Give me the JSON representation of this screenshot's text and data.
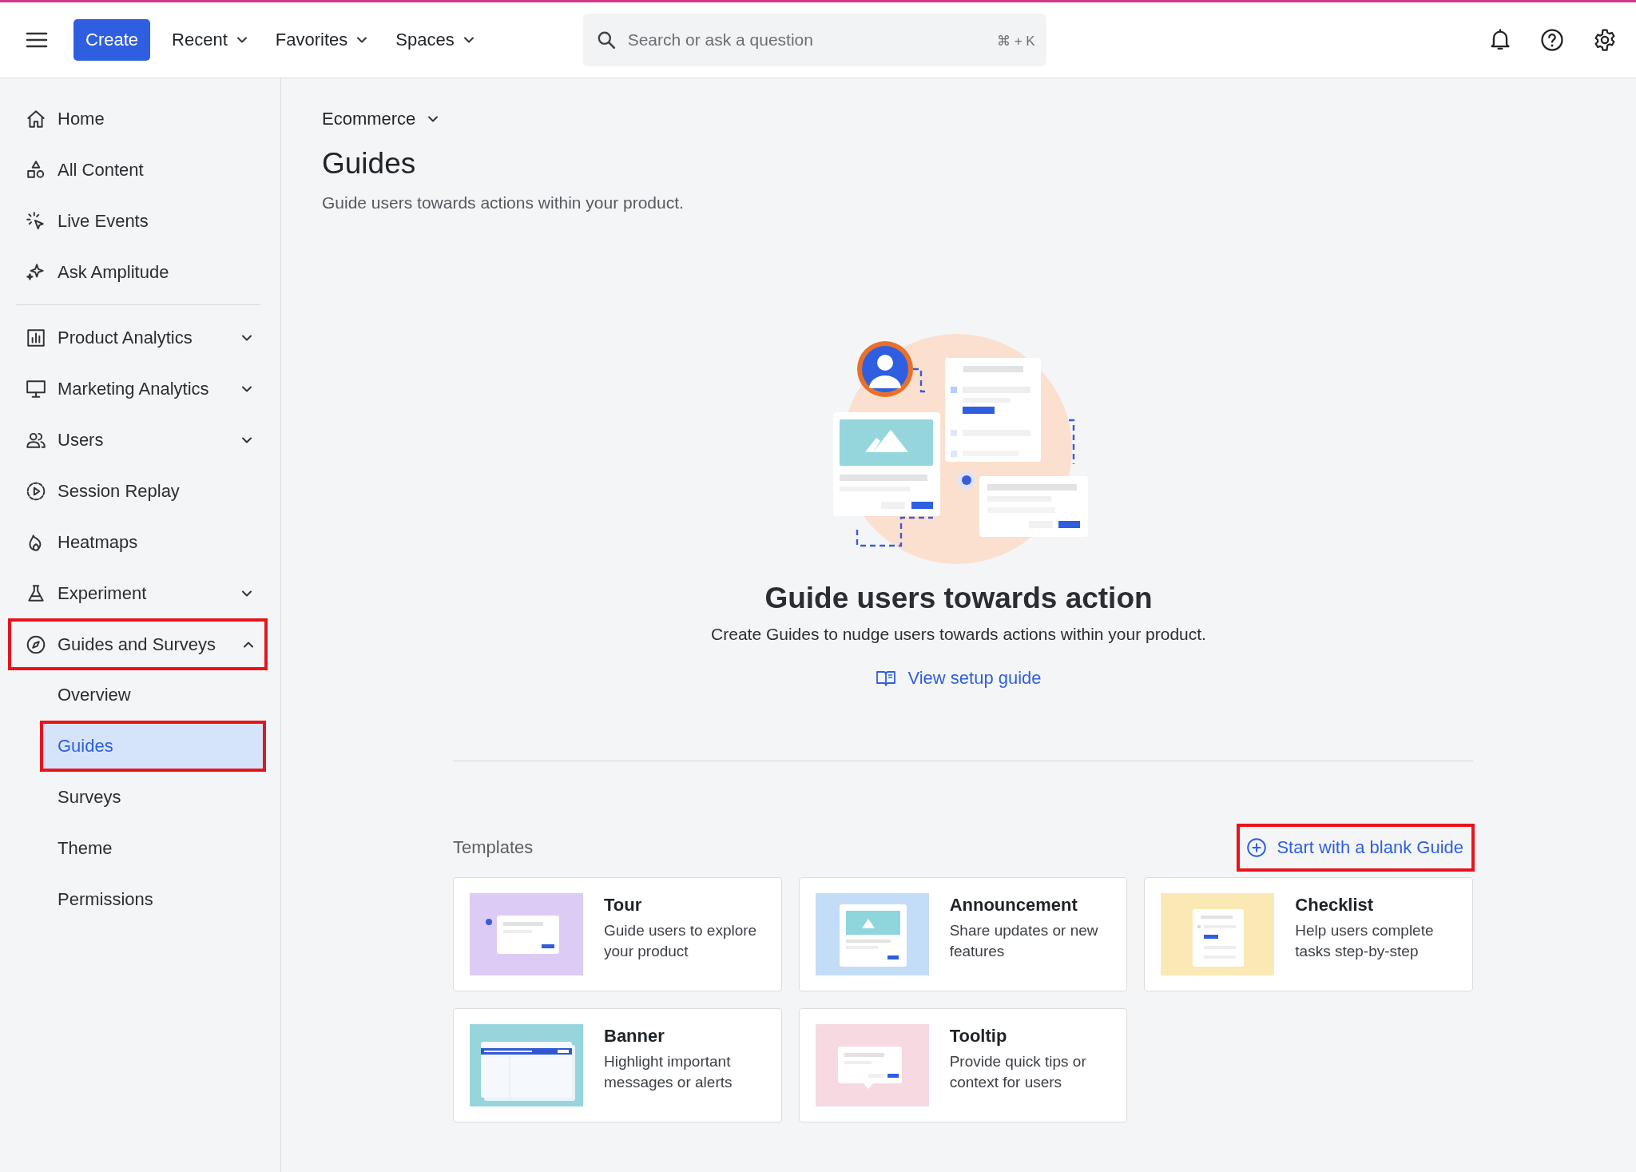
{
  "topbar": {
    "create_button": "Create",
    "menus": [
      {
        "label": "Recent"
      },
      {
        "label": "Favorites"
      },
      {
        "label": "Spaces"
      }
    ],
    "search": {
      "placeholder": "Search or ask a question",
      "shortcut": "⌘ + K"
    }
  },
  "sidebar": {
    "sections": [
      [
        {
          "label": "Home",
          "kind": "item",
          "annotated": false
        },
        {
          "label": "All Content",
          "kind": "item",
          "annotated": false
        },
        {
          "label": "Live Events",
          "kind": "item",
          "annotated": false
        },
        {
          "label": "Ask Amplitude",
          "kind": "item",
          "annotated": false
        }
      ],
      [
        {
          "label": "Product Analytics",
          "kind": "group",
          "expanded": false,
          "annotated": false
        },
        {
          "label": "Marketing Analytics",
          "kind": "group",
          "expanded": false,
          "annotated": false
        },
        {
          "label": "Users",
          "kind": "group",
          "expanded": false,
          "annotated": false
        },
        {
          "label": "Session Replay",
          "kind": "item",
          "annotated": false
        },
        {
          "label": "Heatmaps",
          "kind": "item",
          "annotated": false
        },
        {
          "label": "Experiment",
          "kind": "group",
          "expanded": false,
          "annotated": false
        },
        {
          "label": "Guides and Surveys",
          "kind": "group",
          "expanded": true,
          "annotated": true,
          "children": [
            {
              "label": "Overview",
              "selected": false,
              "annotated": false
            },
            {
              "label": "Guides",
              "selected": true,
              "annotated": true
            },
            {
              "label": "Surveys",
              "selected": false,
              "annotated": false
            },
            {
              "label": "Theme",
              "selected": false,
              "annotated": false
            },
            {
              "label": "Permissions",
              "selected": false,
              "annotated": false
            }
          ]
        }
      ]
    ]
  },
  "main": {
    "project": "Ecommerce",
    "title": "Guides",
    "subtitle": "Guide users towards actions within your product.",
    "empty_state": {
      "heading": "Guide users towards action",
      "description": "Create Guides to nudge users towards actions within your product.",
      "link": "View setup guide"
    },
    "templates": {
      "label": "Templates",
      "blank_button": {
        "label": "Start with a blank Guide",
        "annotated": true
      },
      "cards": [
        {
          "title": "Tour",
          "description": "Guide users to explore your product"
        },
        {
          "title": "Announcement",
          "description": "Share updates or new features"
        },
        {
          "title": "Checklist",
          "description": "Help users complete tasks step-by-step"
        },
        {
          "title": "Banner",
          "description": "Highlight important messages or alerts"
        },
        {
          "title": "Tooltip",
          "description": "Provide quick tips or context for users"
        }
      ]
    }
  }
}
